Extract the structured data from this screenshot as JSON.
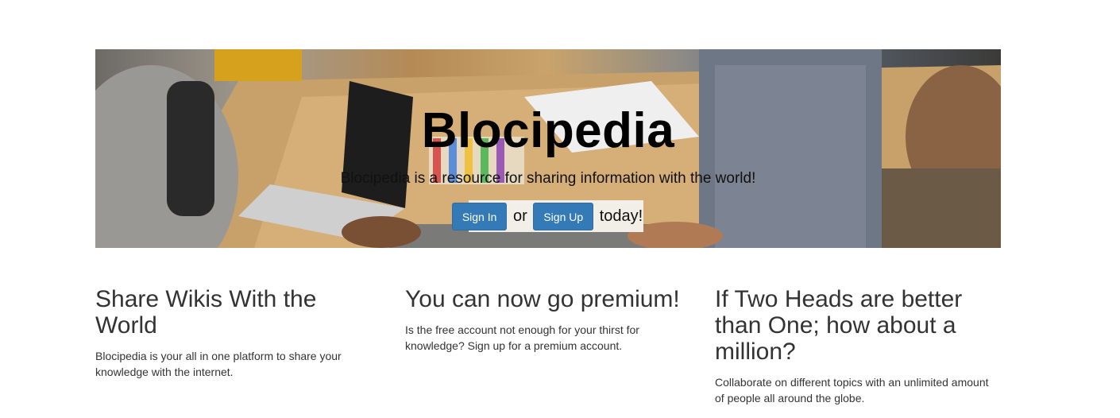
{
  "hero": {
    "title": "Blocipedia",
    "tagline": "Blocipedia is a resource for sharing information with the world!",
    "signin_label": "Sign In",
    "or_word": "or",
    "signup_label": "Sign Up",
    "suffix": "today!"
  },
  "features": [
    {
      "heading": "Share Wikis With the World",
      "body": "Blocipedia is your all in one platform to share your knowledge with the internet."
    },
    {
      "heading": "You can now go premium!",
      "body": "Is the free account not enough for your thirst for knowledge? Sign up for a premium account."
    },
    {
      "heading": "If Two Heads are better than One; how about a million?",
      "body": "Collaborate on different topics with an unlimited amount of people all around the globe."
    }
  ],
  "colors": {
    "primary_button": "#337ab7",
    "text": "#333333"
  }
}
